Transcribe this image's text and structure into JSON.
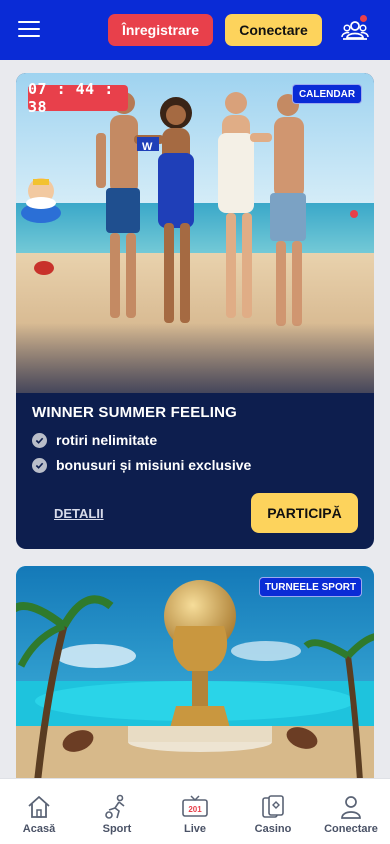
{
  "header": {
    "register_label": "Înregistrare",
    "login_label": "Conectare",
    "colors": {
      "bar": "#0a2bd6",
      "register": "#e8404b",
      "login": "#fdd35c"
    }
  },
  "promo1": {
    "timer": "07 : 44 : 38",
    "tag": "CALENDAR",
    "title": "WINNER SUMMER FEELING",
    "features": [
      "rotiri nelimitate",
      "bonusuri și misiuni exclusive"
    ],
    "details_label": "DETALII",
    "cta_label": "PARTICIPĂ",
    "shirt_badge": "W"
  },
  "promo2": {
    "tag": "TURNEELE SPORT"
  },
  "bottom_nav": {
    "items": [
      {
        "label": "Acasă",
        "icon": "home-icon"
      },
      {
        "label": "Sport",
        "icon": "football-player-icon"
      },
      {
        "label": "Live",
        "icon": "tv-icon",
        "badge": "201"
      },
      {
        "label": "Casino",
        "icon": "cards-icon"
      },
      {
        "label": "Conectare",
        "icon": "user-icon"
      }
    ]
  }
}
